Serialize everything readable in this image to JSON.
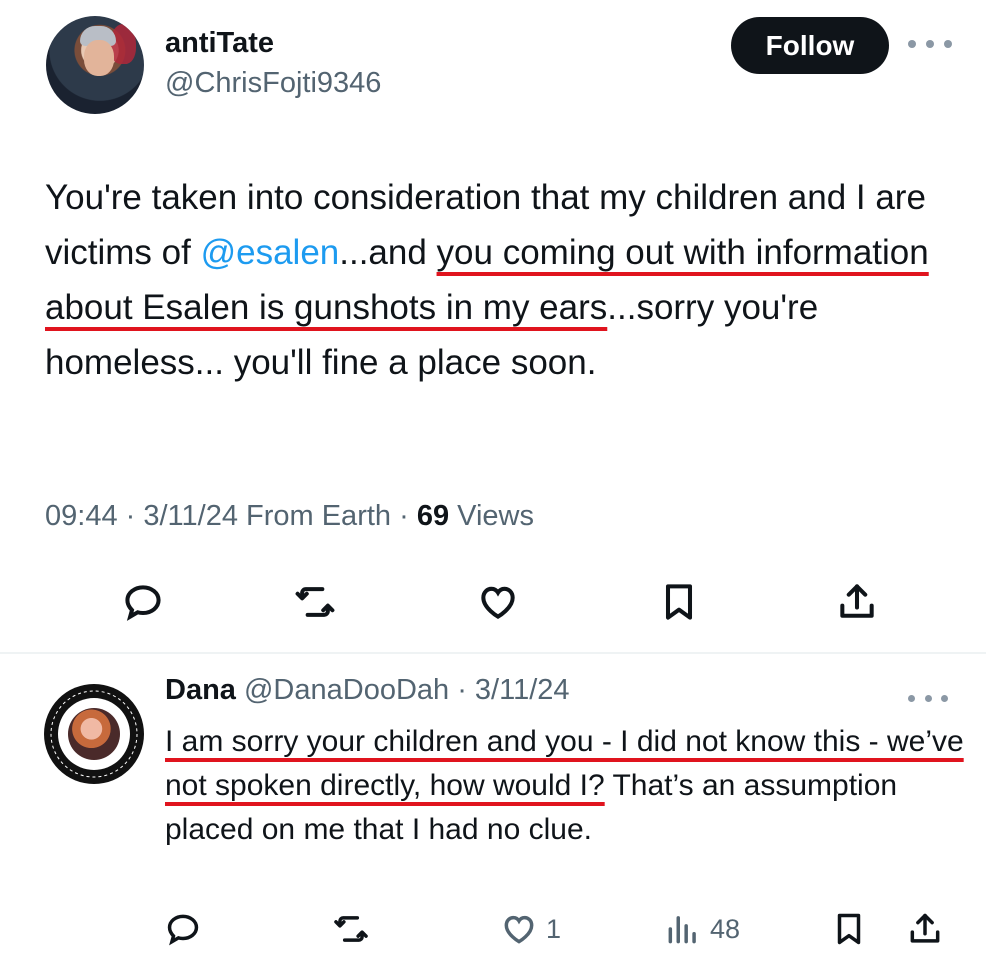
{
  "post": {
    "display_name": "antiTate",
    "handle": "@ChrisFojti9346",
    "follow_label": "Follow",
    "text": {
      "p1": "You're taken into consideration that my children and I are victims of ",
      "mention": "@esalen",
      "p2": "...and ",
      "underlined1": "you coming out with information about Esalen is gunshots in my ears",
      "p3": "...sorry you're homeless... you'll fine a place soon."
    },
    "meta": {
      "time_date": "09:44 · 3/11/24 From Earth · ",
      "views_count": "69",
      "views_label": " Views"
    }
  },
  "reply": {
    "display_name": "Dana",
    "handle_date": " @DanaDooDah · 3/11/24",
    "text": {
      "underlined": "I am sorry your children and you - I did not know this - we’ve not spoken directly, how would I?",
      "rest": " That’s an assumption placed on me that I had no clue."
    },
    "like_count": "1",
    "views_count": "48"
  },
  "colors": {
    "accent_link": "#1d9bf0",
    "follow_bg": "#0f1419",
    "underline_red": "#e0141e",
    "muted": "#536471"
  },
  "icons": [
    "reply-icon",
    "repost-icon",
    "like-icon",
    "bookmark-icon",
    "share-icon",
    "views-icon",
    "more-icon"
  ]
}
